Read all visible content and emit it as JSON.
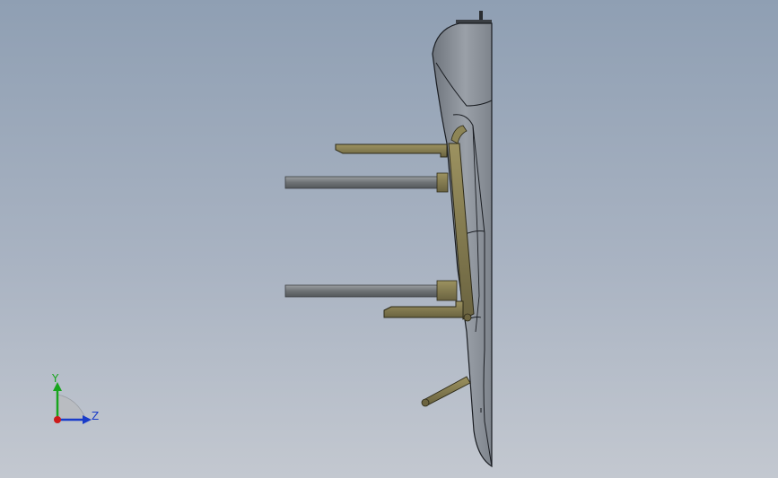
{
  "viewport": {
    "background_top": "#8f9fb3",
    "background_bottom": "#c3c8d0"
  },
  "model": {
    "body_color": "#8b9097",
    "body_edge_color": "#1a1d22",
    "bracket_color": "#7d7549",
    "rod_color": "#7a7e80",
    "icon": "cad-part-side-view"
  },
  "triad": {
    "y_label": "Y",
    "z_label": "Z",
    "y_color": "#18a51d",
    "z_color": "#1a3cc9",
    "x_color": "#cc1a1a",
    "icon": "coordinate-triad-icon"
  }
}
